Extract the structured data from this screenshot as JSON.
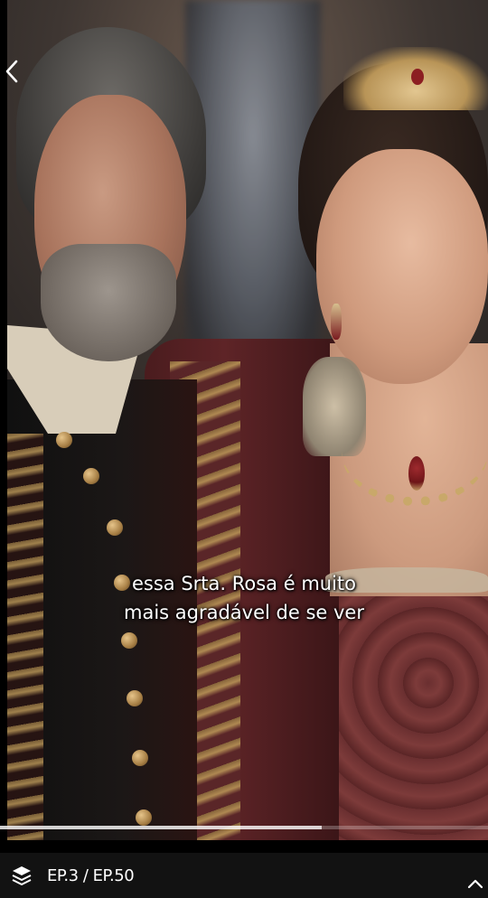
{
  "player": {
    "subtitle_lines": [
      "essa Srta. Rosa é muito",
      "mais agradável de se ver"
    ],
    "progress": 0.66
  },
  "episode_bar": {
    "label": "EP.3 / EP.50",
    "icon": "layers-icon"
  },
  "nav": {
    "back_icon": "chevron-left-icon",
    "expand_icon": "chevron-up-icon"
  },
  "colors": {
    "bar_background": "#121212",
    "subtitle_text": "#ffffff"
  }
}
